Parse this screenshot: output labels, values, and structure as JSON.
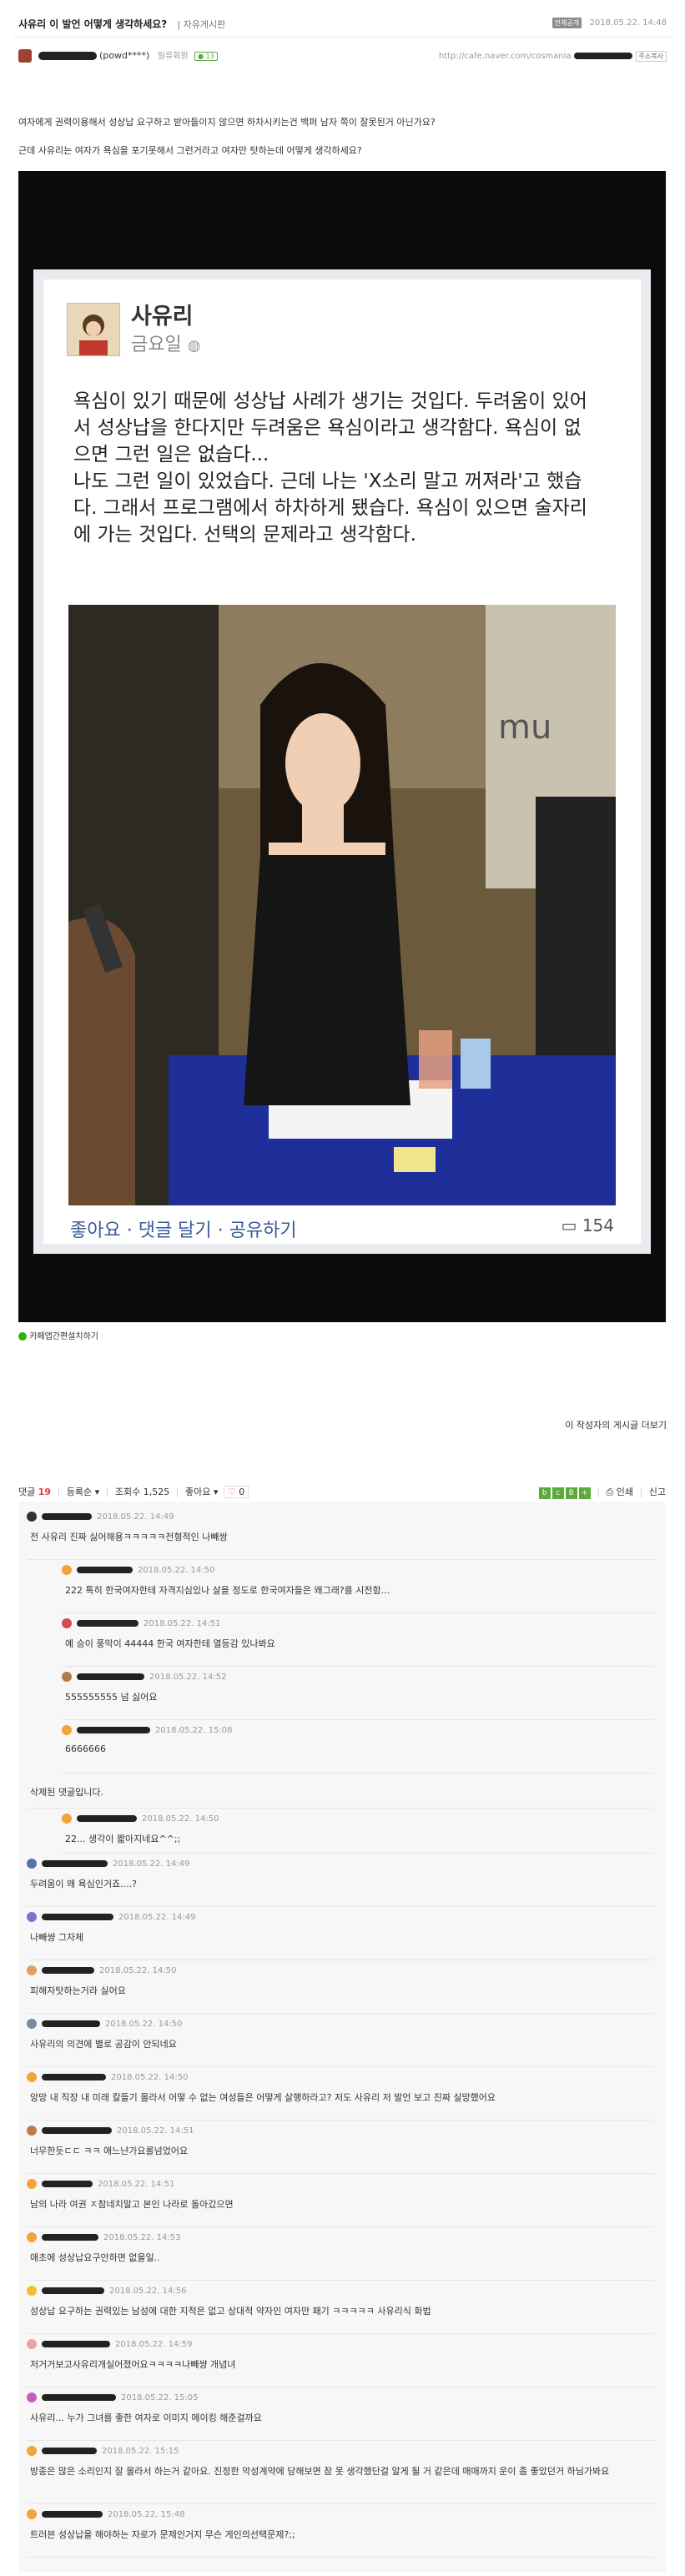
{
  "header": {
    "title": "사유리 이 발언 어떻게 생각하세요?",
    "board": "자유게시판",
    "badge": "전체공개",
    "datetime": "2018.05.22. 14:48",
    "author_suffix": "(powd****)",
    "member_level": "일류회원",
    "level_badge": "13",
    "url_prefix": "http://cafe.naver.com/cosmania",
    "url_suffix": "주소복사"
  },
  "body": {
    "line1": "여자에게 권력이용해서 성상납 요구하고 받아들이지 않으면 하차시키는건 백퍼 남자 쪽이 잘못된거 아닌가요?",
    "line2": "근데 사유리는 여자가 욕심을 포기못해서 그런거라고 여자만 탓하는데 어떻게 생각하세요?"
  },
  "fb_post": {
    "name": "사유리",
    "day": "금요일",
    "text_lines": [
      "욕심이 있기 때문에 성상납 사례가 생기는 것입다. 두려움이 있어",
      "서 성상납을 한다지만 두려움은 욕심이라고 생각함다. 욕심이 없",
      "으면 그런 일은 없습다...",
      "나도 그런 일이 있었습다. 근데 나는 'X소리 말고 꺼져라'고 했습",
      "다. 그래서 프로그램에서 하차하게 됐습다. 욕심이 있으면 술자리",
      "에 가는 것입다. 선택의 문제라고 생각함다."
    ],
    "actions": "좋아요 · 댓글 달기 · 공유하기",
    "comment_count": "154"
  },
  "cafe_link": "카페앱간편설치하기",
  "more_link": "이 작성자의 게시글 더보기",
  "comment_bar": {
    "label": "댓글",
    "count": "19",
    "sort": "등록순",
    "views_label": "조회수",
    "views": "1,525",
    "like_label": "좋아요",
    "like_count": "0",
    "print": "인쇄",
    "report": "신고"
  },
  "comments": [
    {
      "time": "2018.05.22. 14:49",
      "text": "전 사유리 진짜 싫어해용ㅋㅋㅋㅋㅋ전형적인 나빼쌍",
      "indent": 0,
      "color": "#333333"
    },
    {
      "time": "2018.05.22. 14:50",
      "text": "222 특히 한국여자한테 자격지심있나 살을 정도로 한국여자들은 왜그래?를 시전함...",
      "indent": 1,
      "color": "#f2a33a"
    },
    {
      "time": "2018.05.22. 14:51",
      "text": "예 승이 풍막이 44444 한국 여자한테 열등감 있나봐요",
      "indent": 1,
      "color": "#d94a4a"
    },
    {
      "time": "2018.05.22. 14:52",
      "text": "555555555 넘 싫어요",
      "indent": 1,
      "color": "#b07a4a"
    },
    {
      "time": "2018.05.22. 15:08",
      "text": "6666666",
      "indent": 1,
      "color": "#f2a33a"
    },
    {
      "time": "",
      "text": "삭제된 댓글입니다.",
      "indent": 0,
      "color": ""
    },
    {
      "time": "2018.05.22. 14:50",
      "text": "22... 생각이 짧아지네요^^;;",
      "indent": 1,
      "color": "#f2a33a"
    },
    {
      "time": "2018.05.22. 14:49",
      "text": "두려움이 왜 욕심인거죠....?",
      "indent": 0,
      "color": "#5a6fb5"
    },
    {
      "time": "2018.05.22. 14:49",
      "text": "나빼썅 그자체",
      "indent": 0,
      "color": "#8a6ad0"
    },
    {
      "time": "2018.05.22. 14:50",
      "text": "피해자탓하는거라 싫어요",
      "indent": 0,
      "color": "#e0a060"
    },
    {
      "time": "2018.05.22. 14:50",
      "text": "사유리의 의견에 별로 공감이 안되네요",
      "indent": 0,
      "color": "#7a8aa0"
    },
    {
      "time": "2018.05.22. 14:50",
      "text": "앙망 내 직장 내 미래 칼들기 몰라서 어떻 수 없는 여성들은 어떻게 살행하라고? 저도 사유리 저 발언 보고 진짜 실망했어요",
      "indent": 0,
      "color": "#f2a33a"
    },
    {
      "time": "2018.05.22. 14:51",
      "text": "너무한듯ㄷㄷ ㅋㅋ 애느냔가요롤넘었어요",
      "indent": 0,
      "color": "#c07a50"
    },
    {
      "time": "2018.05.22. 14:51",
      "text": "남의 나라 여권 ㅈ참네치말고 본인 나라로 돌아갔으면",
      "indent": 0,
      "color": "#f2a33a"
    },
    {
      "time": "2018.05.22. 14:53",
      "text": "애초에 성상납요구안하면 없을일..",
      "indent": 0,
      "color": "#f2a33a"
    },
    {
      "time": "2018.05.22. 14:56",
      "text": "성상납 요구하는 권력있는 남성에 대한 지적은 없고 상대적 약자인 여자만 패기 ㅋㅋㅋㅋㅋ 사유리식 화법",
      "indent": 0,
      "color": "#f0c030"
    },
    {
      "time": "2018.05.22. 14:59",
      "text": "저거거보고사유리개실어졌어요ㅋㅋㅋㅋ나빼썅 개념녀",
      "indent": 0,
      "color": "#f0a0a0"
    },
    {
      "time": "2018.05.22. 15:05",
      "text": "사유리... 누가 그녀를 좋한 여자로 이미지 메이킹 해준걸까요",
      "indent": 0,
      "color": "#c060c0"
    },
    {
      "time": "2018.05.22. 15:15",
      "text": "방종은 많은 소리인지 잘 몰라서 하는거 같아요. 진정한 악성계약에 당해보면 잠 못 생각했단걸 알게 될 거 같은데 매매까지 운이 좀 좋았던거 하님가봐요",
      "indent": 0,
      "color": "#f2a33a",
      "text2": ""
    },
    {
      "time": "2018.05.22. 15:48",
      "text": "트러븐 성상납을 해야하는 자로가 문제인거지 무슨 게인의선택문제?;;",
      "indent": 0,
      "color": "#f2a33a"
    }
  ]
}
